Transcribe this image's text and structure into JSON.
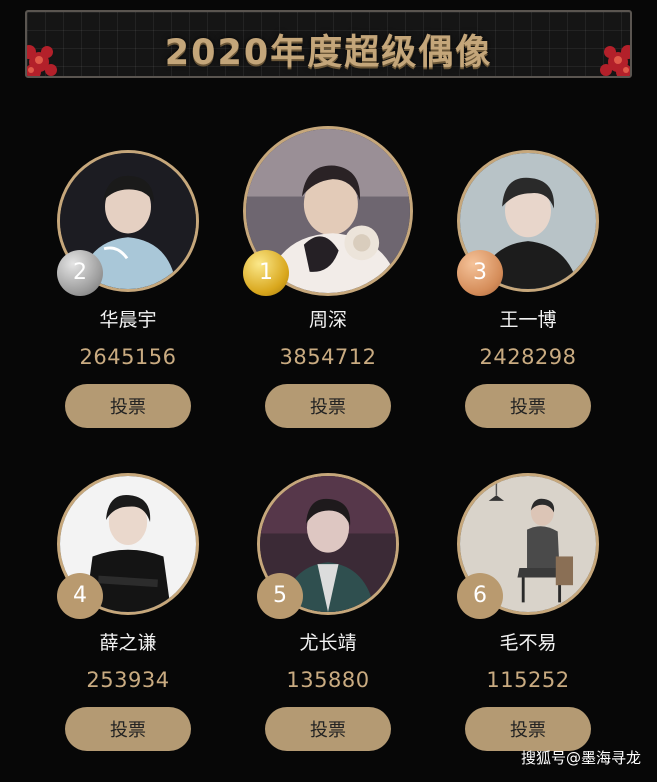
{
  "banner": {
    "title": "2020年度超级偶像"
  },
  "colors": {
    "background": "#070707",
    "accent_gold": "#c6a77b",
    "button": "#b49a73",
    "votes_text": "#c9ab81"
  },
  "idols": [
    {
      "rank": "2",
      "name": "华晨宇",
      "votes": "2645156",
      "vote_label": "投票"
    },
    {
      "rank": "1",
      "name": "周深",
      "votes": "3854712",
      "vote_label": "投票"
    },
    {
      "rank": "3",
      "name": "王一博",
      "votes": "2428298",
      "vote_label": "投票"
    },
    {
      "rank": "4",
      "name": "薛之谦",
      "votes": "253934",
      "vote_label": "投票"
    },
    {
      "rank": "5",
      "name": "尤长靖",
      "votes": "135880",
      "vote_label": "投票"
    },
    {
      "rank": "6",
      "name": "毛不易",
      "votes": "115252",
      "vote_label": "投票"
    }
  ],
  "watermark": "搜狐号@墨海寻龙"
}
